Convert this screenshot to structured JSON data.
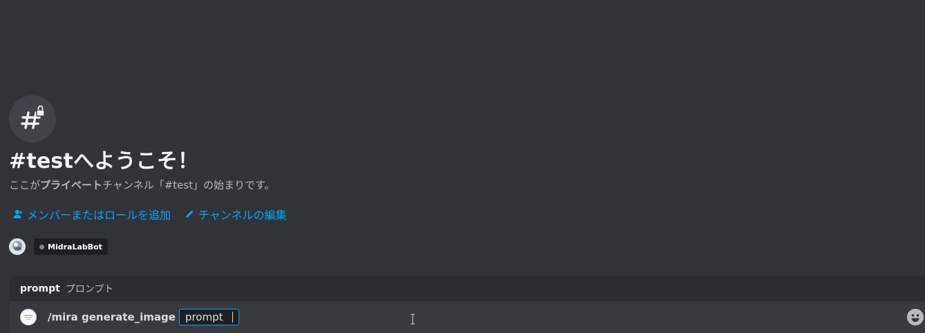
{
  "welcome": {
    "title": "#testへようこそ！",
    "desc_prefix": "ここが",
    "desc_bold": "プライベート",
    "desc_suffix": "チャンネル「#test」の始まりです。"
  },
  "actions": {
    "add_members": "メンバーまたはロールを追加",
    "edit_channel": "チャンネルの編集"
  },
  "member": {
    "bot_name": "MidraLabBot",
    "status_color": "#80848e"
  },
  "option_hint": {
    "name": "prompt",
    "description": "プロンプト"
  },
  "composer": {
    "command": "/mira generate_image",
    "param_label": "prompt"
  },
  "colors": {
    "background": "#313338",
    "link": "#00a8fc",
    "composer": "#383a40",
    "option_bar": "#2b2d31"
  },
  "icons": {
    "channel": "hashtag-lock-icon",
    "add_member": "person-add-icon",
    "edit": "pencil-icon",
    "emoji": "emoji-smile-icon"
  }
}
